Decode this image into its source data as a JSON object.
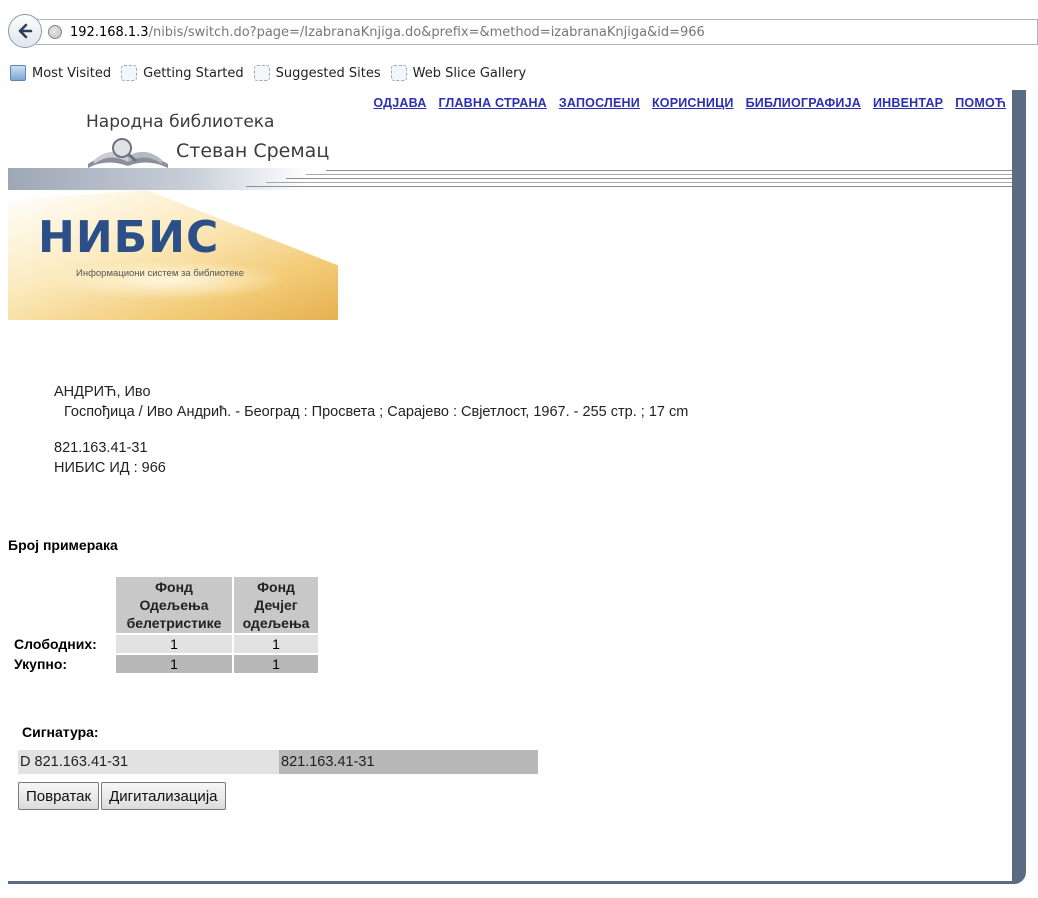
{
  "browser": {
    "url_host": "192.168.1.3",
    "url_path": "/nibis/switch.do?page=/IzabranaKnjiga.do&prefix=&method=izabranaKnjiga&id=966",
    "bookmarks": [
      "Most Visited",
      "Getting Started",
      "Suggested Sites",
      "Web Slice Gallery"
    ]
  },
  "nav": [
    "ОДЈАВА",
    "ГЛАВНА СТРАНА",
    "ЗАПОСЛЕНИ",
    "КОРИСНИЦИ",
    "БИБЛИОГРАФИЈА",
    "ИНВЕНТАР",
    "ПОМОЋ"
  ],
  "library": {
    "line1": "Народна библиотека",
    "line2": "Стеван Сремац"
  },
  "nibis": {
    "title": "НИБИС",
    "subtitle": "Информациони систем за библиотеке"
  },
  "record": {
    "author": "АНДРИЋ, Иво",
    "description": "Госпођица / Иво Андрић. - Београд : Просвета ; Сарајево : Свјетлост, 1967. - 255 стр. ; 17 cm",
    "classification": "821.163.41-31",
    "nibis_id": "НИБИС ИД : 966"
  },
  "copies": {
    "title": "Број примерака",
    "columns": [
      [
        "Фонд",
        "Одељења",
        "белетристике"
      ],
      [
        "Фонд",
        "Дечјег",
        "одељења"
      ]
    ],
    "rows": [
      {
        "label": "Слободних:",
        "values": [
          "1",
          "1"
        ]
      },
      {
        "label": "Укупно:",
        "values": [
          "1",
          "1"
        ]
      }
    ]
  },
  "signature": {
    "title": "Сигнатура:",
    "values": [
      "D 821.163.41-31",
      "821.163.41-31"
    ]
  },
  "buttons": {
    "back": "Повратак",
    "digitize": "Дигитализација"
  }
}
